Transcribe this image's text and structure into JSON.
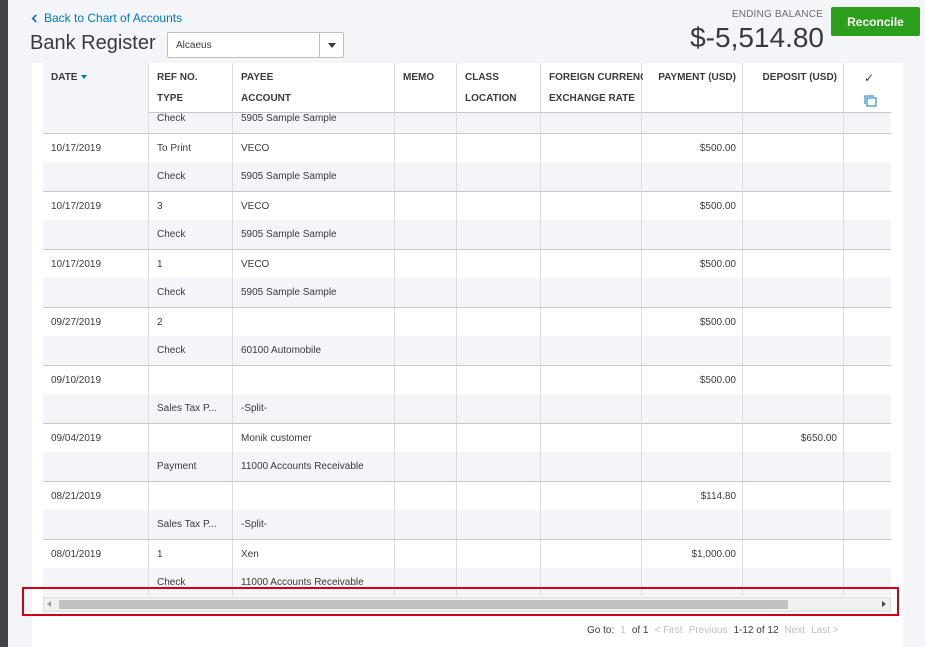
{
  "nav": {
    "back_label": "Back to Chart of Accounts"
  },
  "header": {
    "title": "Bank Register",
    "account_selected": "Alcaeus",
    "ending_balance_label": "ENDING BALANCE",
    "ending_balance_value": "$-5,514.80",
    "reconcile_label": "Reconcile",
    "reconcile_color": "#2ca01c"
  },
  "columns": {
    "date": "DATE",
    "ref_no": "REF NO.",
    "type": "TYPE",
    "payee": "PAYEE",
    "account": "ACCOUNT",
    "memo": "MEMO",
    "class": "CLASS",
    "location": "LOCATION",
    "foreign_currency": "FOREIGN CURRENC",
    "exchange_rate": "EXCHANGE RATE",
    "payment": "PAYMENT (USD)",
    "deposit": "DEPOSIT (USD)",
    "check_glyph": "✓"
  },
  "partial_row": {
    "type": "Check",
    "account": "5905 Sample Sample"
  },
  "transactions": [
    {
      "date": "10/17/2019",
      "ref": "To Print",
      "payee": "VECO",
      "payment": "$500.00",
      "deposit": "",
      "type": "Check",
      "account": "5905 Sample Sample"
    },
    {
      "date": "10/17/2019",
      "ref": "3",
      "payee": "VECO",
      "payment": "$500.00",
      "deposit": "",
      "type": "Check",
      "account": "5905 Sample Sample"
    },
    {
      "date": "10/17/2019",
      "ref": "1",
      "payee": "VECO",
      "payment": "$500.00",
      "deposit": "",
      "type": "Check",
      "account": "5905 Sample Sample"
    },
    {
      "date": "09/27/2019",
      "ref": "2",
      "payee": "",
      "payment": "$500.00",
      "deposit": "",
      "type": "Check",
      "account": "60100 Automobile"
    },
    {
      "date": "09/10/2019",
      "ref": "",
      "payee": "",
      "payment": "$500.00",
      "deposit": "",
      "type": "Sales Tax P...",
      "account": "-Split-"
    },
    {
      "date": "09/04/2019",
      "ref": "",
      "payee": "Monik customer",
      "payment": "",
      "deposit": "$650.00",
      "type": "Payment",
      "account": "11000 Accounts Receivable"
    },
    {
      "date": "08/21/2019",
      "ref": "",
      "payee": "",
      "payment": "$114.80",
      "deposit": "",
      "type": "Sales Tax P...",
      "account": "-Split-"
    },
    {
      "date": "08/01/2019",
      "ref": "1",
      "payee": "Xen",
      "payment": "$1,000.00",
      "deposit": "",
      "type": "Check",
      "account": "11000 Accounts Receivable"
    }
  ],
  "pager": {
    "goto_label": "Go to:",
    "goto_page": "1",
    "of_pages": "of 1",
    "first": "< First",
    "previous": "Previous",
    "range": "1-12 of 12",
    "next": "Next",
    "last": "Last >"
  }
}
